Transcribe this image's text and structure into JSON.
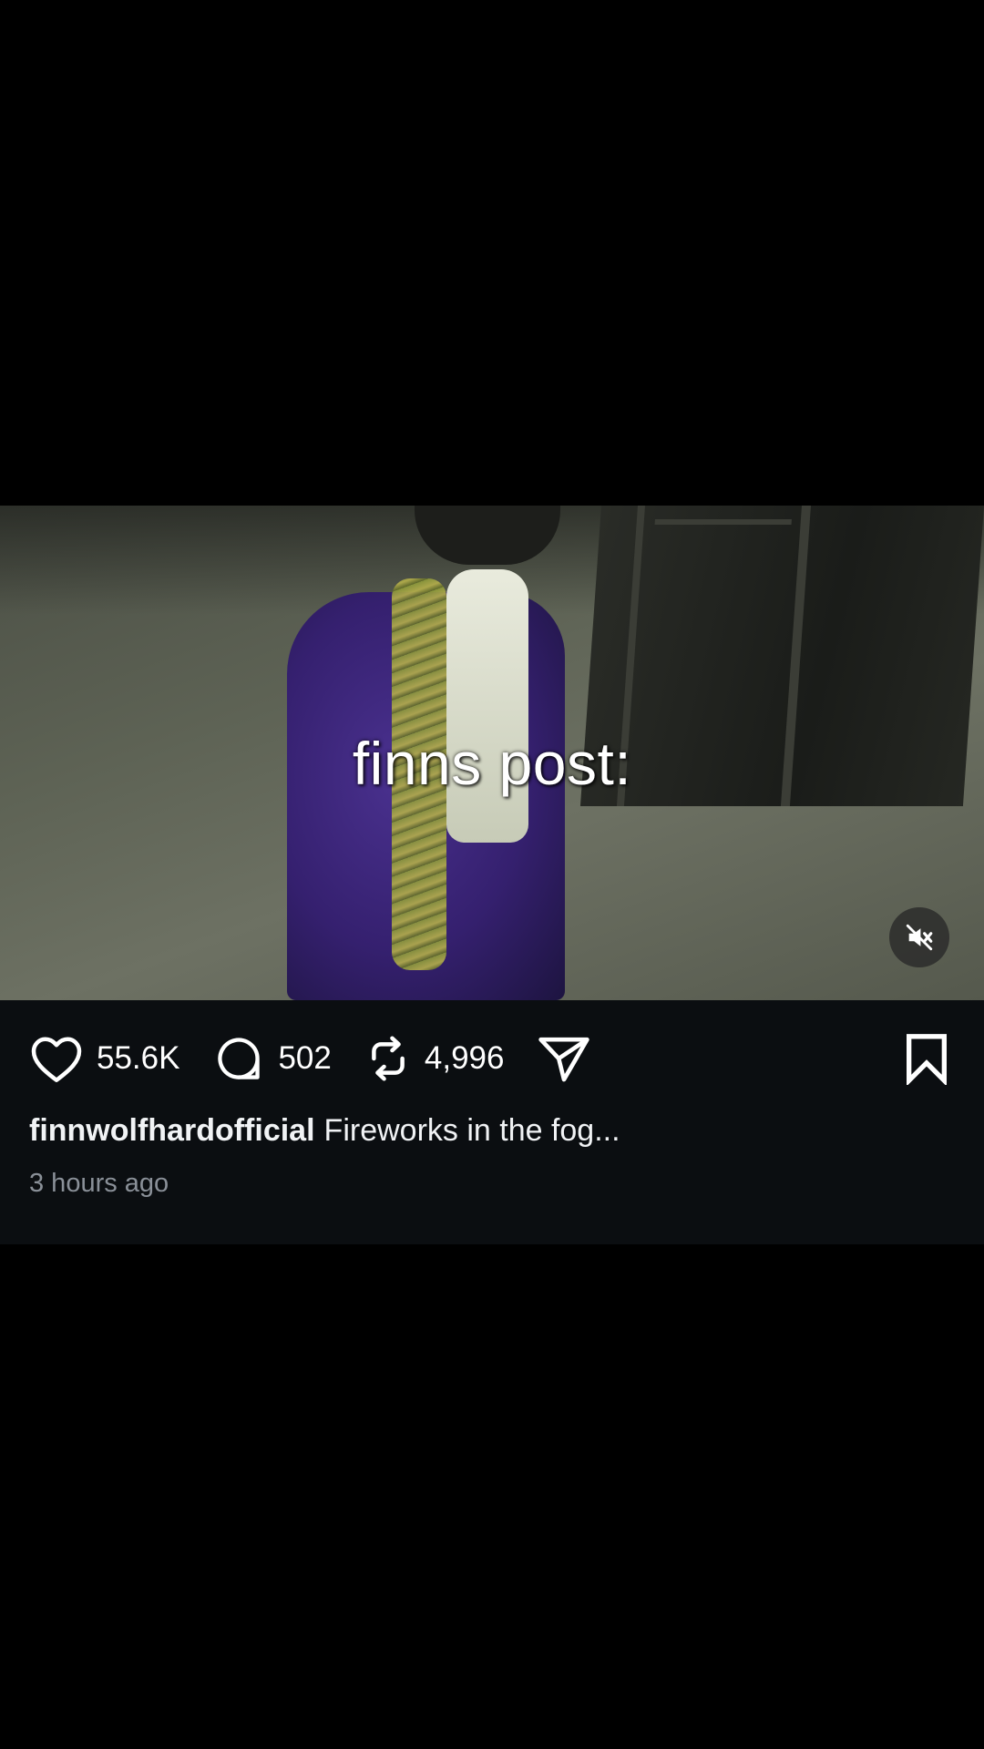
{
  "video": {
    "overlay_text": "finns post:",
    "mute_icon": "speaker-muted-icon"
  },
  "actions": {
    "likes": {
      "icon": "heart-icon",
      "count": "55.6K"
    },
    "comments": {
      "icon": "comment-bubble-icon",
      "count": "502"
    },
    "reposts": {
      "icon": "repost-icon",
      "count": "4,996"
    },
    "share": {
      "icon": "send-icon"
    },
    "save": {
      "icon": "bookmark-icon"
    }
  },
  "post": {
    "username": "finnwolfhardofficial",
    "caption": "Fireworks in the fog...",
    "timestamp": "3 hours ago"
  },
  "colors": {
    "background": "#000000",
    "panel": "#0b0e11",
    "text_primary": "#ffffff",
    "text_secondary": "#8a9098"
  }
}
